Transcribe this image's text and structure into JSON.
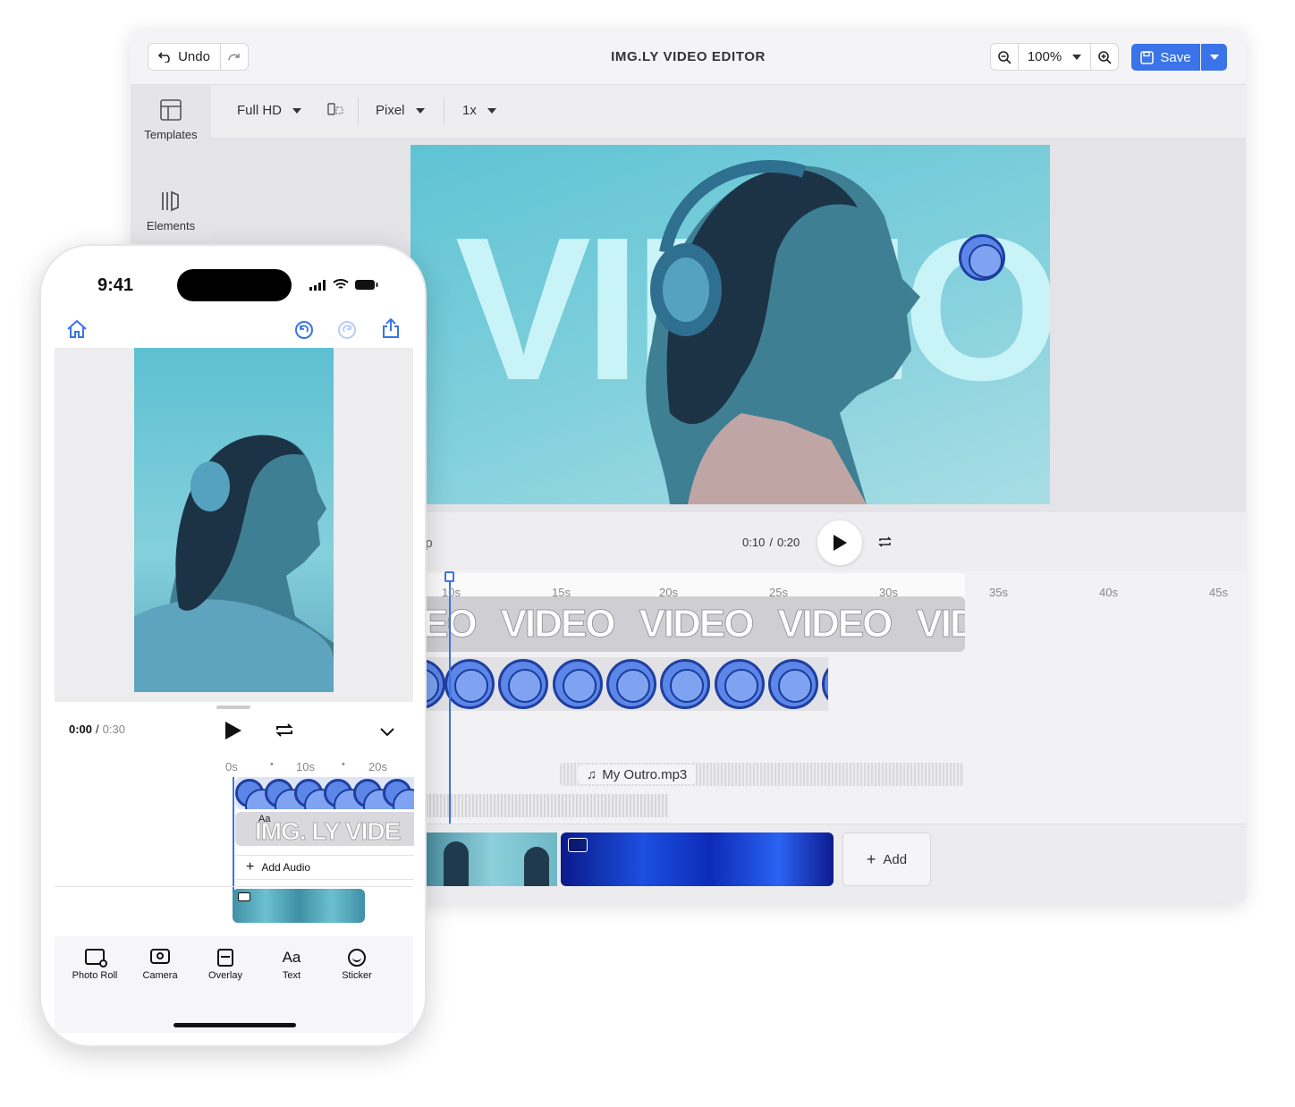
{
  "desktop": {
    "undo_label": "Undo",
    "title": "IMG.LY VIDEO EDITOR",
    "zoom": "100%",
    "save_label": "Save",
    "sidebar": [
      {
        "label": "Templates"
      },
      {
        "label": "Elements"
      }
    ],
    "settings": {
      "resolution": "Full HD",
      "unit": "Pixel",
      "scale": "1x"
    },
    "canvas_text": "VIDEO",
    "partial_clip_label": "ip",
    "time_current": "0:10",
    "time_separator": "/",
    "time_total": "0:20",
    "ruler": [
      "10s",
      "15s",
      "20s",
      "25s",
      "30s",
      "35s",
      "40s",
      "45s"
    ],
    "text_track": "VIDEO",
    "text_track_leading": "EO",
    "text_track_trailing": "VIDE",
    "audio_name": "My Outro.mp3",
    "add_label": "Add"
  },
  "phone": {
    "time": "9:41",
    "time_current": "0:00",
    "time_separator": "/",
    "time_total": "0:30",
    "ruler": [
      "0s",
      "10s",
      "20s"
    ],
    "text_badge": "Aa",
    "text_clip": "IMG. LY VIDE",
    "add_audio": "Add Audio",
    "toolbar": [
      {
        "label": "Photo Roll",
        "icon": "photo-roll-icon"
      },
      {
        "label": "Camera",
        "icon": "camera-icon"
      },
      {
        "label": "Overlay",
        "icon": "overlay-icon"
      },
      {
        "label": "Text",
        "icon": "text-icon"
      },
      {
        "label": "Sticker",
        "icon": "sticker-icon"
      }
    ]
  },
  "colors": {
    "accent": "#3b73e8",
    "canvas_bg": "#6cc8d8",
    "sticker_blue": "#5c86e8"
  }
}
